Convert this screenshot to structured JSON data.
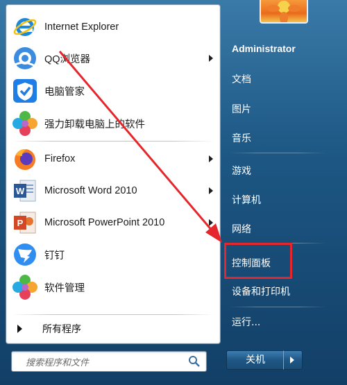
{
  "programs": [
    {
      "label": "Internet Explorer",
      "icon": "internet-explorer-icon",
      "has_submenu": false
    },
    {
      "label": "QQ浏览器",
      "icon": "qq-browser-icon",
      "has_submenu": true
    },
    {
      "label": "电脑管家",
      "icon": "pc-manager-icon",
      "has_submenu": false
    },
    {
      "label": "强力卸载电脑上的软件",
      "icon": "uninstall-software-icon",
      "has_submenu": false
    },
    {
      "label": "Firefox",
      "icon": "firefox-icon",
      "has_submenu": true
    },
    {
      "label": "Microsoft Word 2010",
      "icon": "word-icon",
      "has_submenu": true
    },
    {
      "label": "Microsoft PowerPoint 2010",
      "icon": "powerpoint-icon",
      "has_submenu": true
    },
    {
      "label": "钉钉",
      "icon": "dingtalk-icon",
      "has_submenu": false
    },
    {
      "label": "软件管理",
      "icon": "software-manager-icon",
      "has_submenu": false
    }
  ],
  "all_programs": "所有程序",
  "search": {
    "placeholder": "搜索程序和文件"
  },
  "right": {
    "user": "Administrator",
    "documents": "文档",
    "pictures": "图片",
    "music": "音乐",
    "games": "游戏",
    "computer": "计算机",
    "network": "网络",
    "control_panel": "控制面板",
    "devices_printers": "设备和打印机",
    "run": "运行..."
  },
  "shutdown": {
    "label": "关机"
  },
  "colors": {
    "highlight": "#e5262c",
    "arrow": "#e5262c",
    "menu_blue": "#1d5784"
  }
}
